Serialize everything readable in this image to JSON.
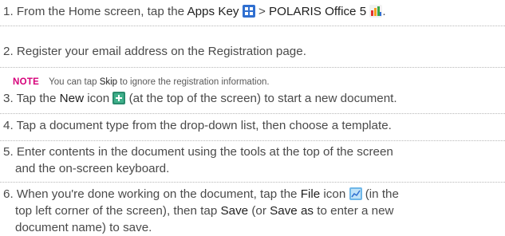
{
  "steps": [
    {
      "num": "1.",
      "parts": {
        "a": "From the Home screen, tap the ",
        "b": "Apps Key",
        "c": " > ",
        "d": "POLARIS Office 5",
        "e": "."
      }
    },
    {
      "num": "2.",
      "text": "Register your email address on the Registration page."
    },
    {
      "num": "3.",
      "parts": {
        "a": "Tap the ",
        "b": "New",
        "c": " icon ",
        "d": " (at the top of the screen) to start a new document."
      }
    },
    {
      "num": "4.",
      "text": "Tap a document type from the drop-down list, then choose a template."
    },
    {
      "num": "5.",
      "line1": "Enter contents in the document using the tools at the top of the screen",
      "line2": "and the on-screen keyboard."
    },
    {
      "num": "6.",
      "parts": {
        "a": "When you're done working on the document, tap the ",
        "b": "File",
        "c": " icon ",
        "d": " (in the",
        "e": "top left corner of the screen), then tap ",
        "f": "Save",
        "g": " (or ",
        "h": "Save as",
        "i": " to enter a new",
        "j": "document name) to save."
      }
    }
  ],
  "note": {
    "label": "NOTE",
    "a": "You can tap ",
    "b": "Skip",
    "c": " to ignore the registration information."
  },
  "colors": {
    "text": "#4a4a4a",
    "note_label": "#d6007a",
    "apps_icon": "#2f6fd0",
    "new_icon": "#2a8c6e",
    "file_icon": "#6fb7e8"
  },
  "icons": {
    "apps": "apps-grid-icon",
    "polaris": "polaris-office-icon",
    "new": "new-document-icon",
    "file": "file-menu-icon"
  }
}
